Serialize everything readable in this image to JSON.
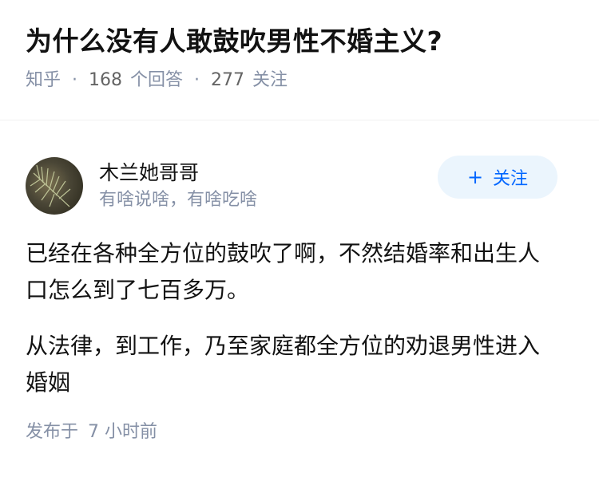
{
  "question": {
    "title": "为什么没有人敢鼓吹男性不婚主义?",
    "source": "知乎",
    "answers_count": "168",
    "answers_label": "个回答",
    "followers_count": "277",
    "followers_label": "关注"
  },
  "author": {
    "name": "木兰她哥哥",
    "bio": "有啥说啥，有啥吃啥",
    "follow_label": "关注",
    "follow_icon": "+"
  },
  "answer": {
    "paragraphs": [
      "已经在各种全方位的鼓吹了啊，不然结婚率和出生人口怎么到了七百多万。",
      "从法律，到工作，乃至家庭都全方位的劝退男性进入婚姻"
    ],
    "posted_prefix": "发布于",
    "posted_time": "7 小时前"
  },
  "colors": {
    "accent": "#0066ff",
    "follow_bg": "#ebf5fd",
    "meta": "#8590a6"
  }
}
